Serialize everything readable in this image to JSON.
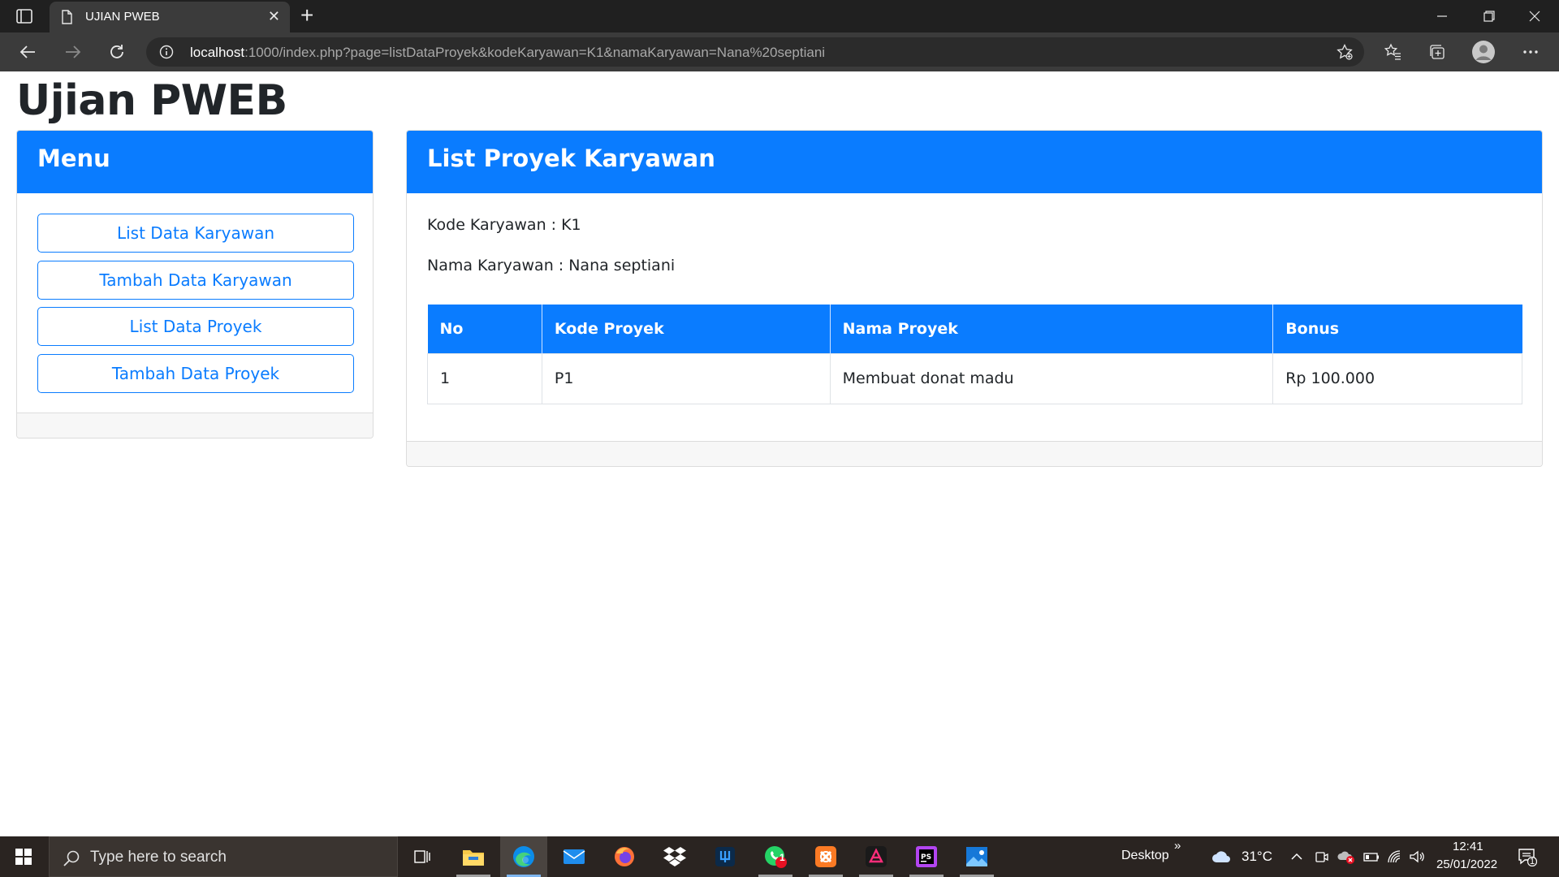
{
  "browser": {
    "tab_title": "UJIAN PWEB",
    "url_host": "localhost",
    "url_rest": ":1000/index.php?page=listDataProyek&kodeKaryawan=K1&namaKaryawan=Nana%20septiani",
    "icons": [
      "tab-actions-icon",
      "page-icon",
      "close-icon",
      "new-tab-icon",
      "minimize-icon",
      "restore-icon",
      "window-close-icon",
      "back-icon",
      "forward-icon",
      "refresh-icon",
      "info-icon",
      "add-favorite-icon",
      "favorites-icon",
      "collections-icon",
      "profile-icon",
      "more-icon"
    ]
  },
  "page": {
    "title": "Ujian PWEB"
  },
  "menu": {
    "header": "Menu",
    "items": [
      {
        "label": "List Data Karyawan"
      },
      {
        "label": "Tambah Data Karyawan"
      },
      {
        "label": "List Data Proyek"
      },
      {
        "label": "Tambah Data Proyek"
      }
    ]
  },
  "main": {
    "header": "List Proyek Karyawan",
    "kode_line": "Kode Karyawan : K1",
    "nama_line": "Nama Karyawan : Nana septiani",
    "table": {
      "columns": [
        "No",
        "Kode Proyek",
        "Nama Proyek",
        "Bonus"
      ],
      "rows": [
        [
          "1",
          "P1",
          "Membuat donat madu",
          "Rp 100.000"
        ]
      ]
    }
  },
  "colors": {
    "primary": "#0a7cff",
    "text": "#212529",
    "chrome_dark": "#202020",
    "taskbar": "#2a2421"
  },
  "taskbar": {
    "search_placeholder": "Type here to search",
    "desktop_label": "Desktop",
    "chevron": "»",
    "temperature": "31°C",
    "time": "12:41",
    "date": "25/01/2022",
    "whatsapp_badge": "1",
    "notification_badge": "1"
  }
}
